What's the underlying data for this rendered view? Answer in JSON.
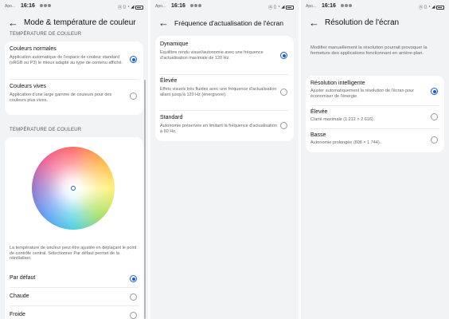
{
  "status_bar": {
    "app": "Apo...",
    "time": "16:16",
    "icons": [
      "nfc-icon",
      "vibrate-icon",
      "wifi-icon",
      "signal-icon"
    ],
    "battery": "battery-icon"
  },
  "panel1": {
    "title": "Mode & température de couleur",
    "top_section": "TEMPÉRATURE DE COULEUR",
    "modes": [
      {
        "title": "Couleurs normales",
        "desc": "Application automatique de l'espace de couleur standard (sRGB ou P3) le mieux adapté au type de contenu affiché.",
        "selected": true
      },
      {
        "title": "Couleurs vives",
        "desc": "Application d'une large gamme de couleurs pour des couleurs plus vives.",
        "selected": false
      }
    ],
    "temp_section": "TEMPÉRATURE DE COULEUR",
    "temp_desc": "La température de couleur peut être ajustée en déplaçant le point de contrôle central. Sélectionner Par défaut permet de la réinitialiser.",
    "options": [
      {
        "label": "Par défaut",
        "selected": true
      },
      {
        "label": "Chaude",
        "selected": false
      },
      {
        "label": "Froide",
        "selected": false
      }
    ]
  },
  "panel2": {
    "title": "Fréquence d'actualisation de l'écran",
    "options": [
      {
        "title": "Dynamique",
        "desc": "Equilibre rendu visuel/autonomie avec une fréquence d'actualisation maximale de 120 Hz.",
        "selected": true
      },
      {
        "title": "Élevée",
        "desc": "Effets visuels très fluides avec une fréquence d'actualisation allant jusqu'à 120 Hz (énergivore).",
        "selected": false
      },
      {
        "title": "Standard",
        "desc": "Autonomie préservée en limitant la fréquence d'actualisation à 60 Hz.",
        "selected": false
      }
    ]
  },
  "panel3": {
    "title": "Résolution de l'écran",
    "intro": "Modifier manuellement la résolution pourrait provoquer la fermeture des applications fonctionnant en arrière-plan.",
    "options": [
      {
        "title": "Résolution intelligente",
        "desc": "Ajuster automatiquement la résolution de l'écran pour économiser de l'énergie.",
        "selected": true
      },
      {
        "title": "Élevée",
        "desc": "Clarté maximale (1 212 × 2 616).",
        "selected": false
      },
      {
        "title": "Basse",
        "desc": "Autonomie prolongée (808 × 1 744).",
        "selected": false
      }
    ]
  },
  "colors": {
    "accent": "#1a5cd9",
    "background": "#f1f3f5",
    "card": "#ffffff"
  }
}
